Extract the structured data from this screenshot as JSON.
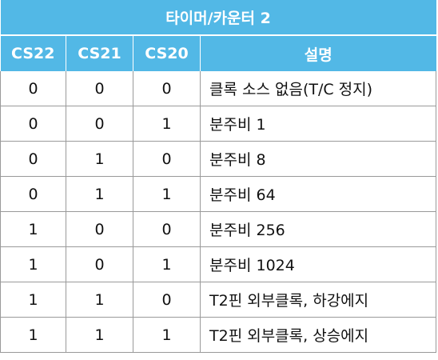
{
  "table": {
    "title": "타이머/카운터 2",
    "headers": [
      "CS22",
      "CS21",
      "CS20",
      "설명"
    ],
    "rows": [
      [
        "0",
        "0",
        "0",
        "클록 소스 없음(T/C 정지)"
      ],
      [
        "0",
        "0",
        "1",
        "분주비 1"
      ],
      [
        "0",
        "1",
        "0",
        "분주비 8"
      ],
      [
        "0",
        "1",
        "1",
        "분주비 64"
      ],
      [
        "1",
        "0",
        "0",
        "분주비 256"
      ],
      [
        "1",
        "0",
        "1",
        "분주비 1024"
      ],
      [
        "1",
        "1",
        "0",
        "T2핀 외부클록, 하강에지"
      ],
      [
        "1",
        "1",
        "1",
        "T2핀 외부클록, 상승에지"
      ]
    ]
  },
  "colors": {
    "header_bg": "#52b8e6",
    "header_text": "#ffffff",
    "grid": "#9a9a9a",
    "cell_text": "#111111"
  }
}
